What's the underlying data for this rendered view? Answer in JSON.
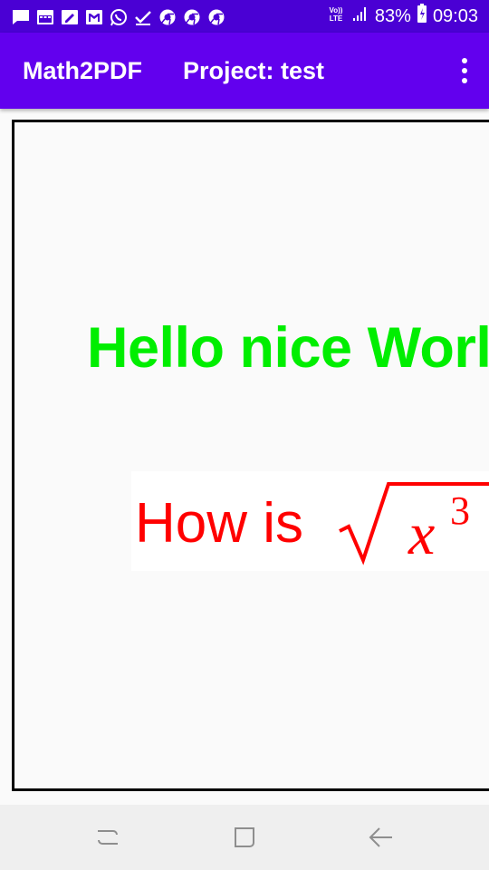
{
  "status_bar": {
    "network_label": "VoLTE",
    "battery_percent": "83%",
    "time": "09:03",
    "notification_icons": [
      "message-icon",
      "calendar-icon",
      "edit-icon",
      "gmail-icon",
      "whatsapp-icon",
      "checkmark-icon",
      "chrome-icon",
      "chrome-icon",
      "chrome-icon"
    ]
  },
  "app_bar": {
    "title": "Math2PDF",
    "project_label": "Project: test",
    "menu_icon": "more-vert-icon"
  },
  "canvas": {
    "heading": "Hello nice World",
    "heading_color": "#00ee00",
    "math_text": "How is",
    "math_text_color": "#ff0000",
    "formula_variable": "x",
    "formula_exponent": "3"
  },
  "nav_bar": {
    "buttons": [
      "recents-icon",
      "home-icon",
      "back-icon"
    ]
  },
  "colors": {
    "status_bar": "#4a00d4",
    "app_bar": "#6200ee",
    "canvas_border": "#000000"
  }
}
